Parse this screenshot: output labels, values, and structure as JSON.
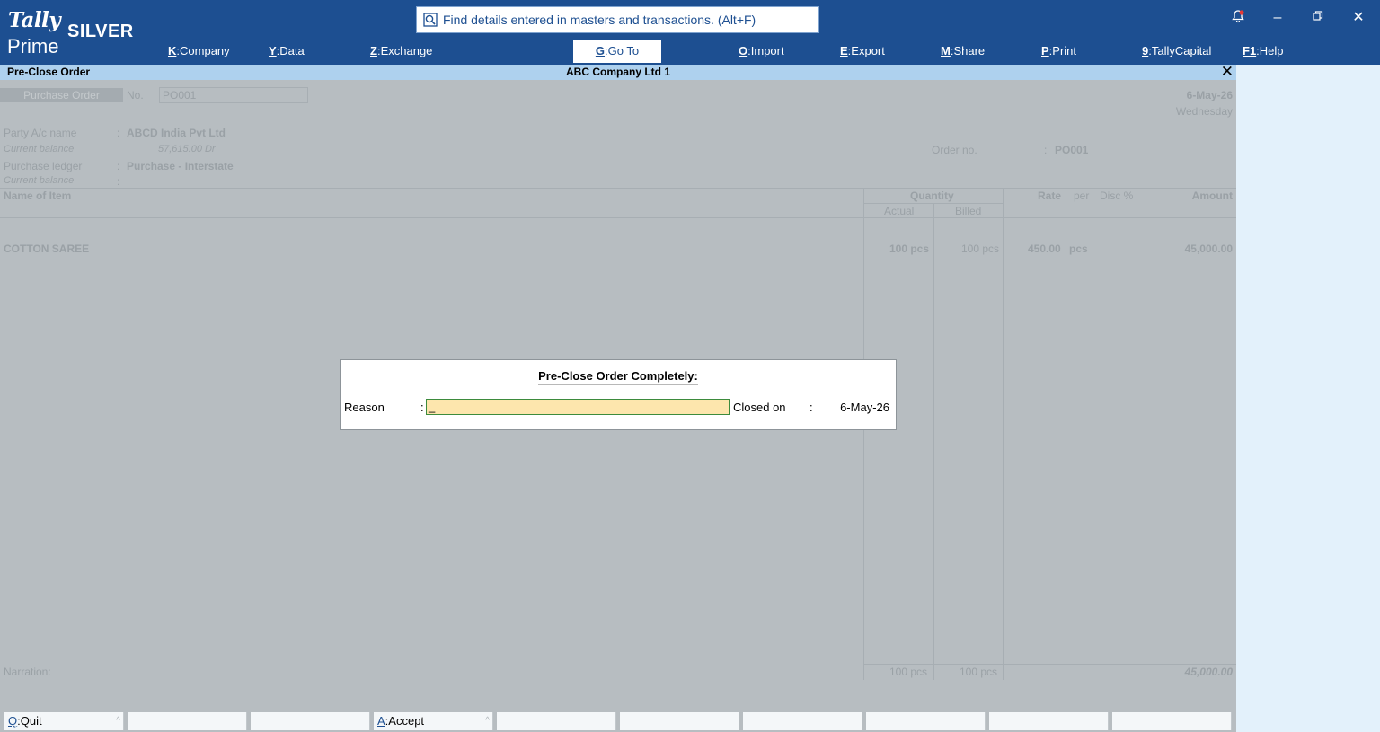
{
  "app": {
    "logo_tally": "Tally",
    "logo_prime": "Prime",
    "edition": "SILVER",
    "search_text": "Find details entered in masters and transactions. (Alt+F)"
  },
  "menu": [
    {
      "key": "K",
      "label": "Company"
    },
    {
      "key": "Y",
      "label": "Data"
    },
    {
      "key": "Z",
      "label": "Exchange"
    },
    {
      "key": "G",
      "label": "Go To"
    },
    {
      "key": "O",
      "label": "Import"
    },
    {
      "key": "E",
      "label": "Export"
    },
    {
      "key": "M",
      "label": "Share"
    },
    {
      "key": "P",
      "label": "Print"
    },
    {
      "key": "9",
      "label": "TallyCapital"
    },
    {
      "key": "F1",
      "label": "Help"
    }
  ],
  "icons": {
    "search": "search-icon",
    "bell": "notification-bell-icon",
    "minimize": "minimize-icon",
    "restore": "restore-icon",
    "close": "close-icon"
  },
  "title": {
    "screen": "Pre-Close Order",
    "company": "ABC Company Ltd 1"
  },
  "voucher": {
    "type": "Purchase Order",
    "no_label": "No.",
    "no_value": "PO001",
    "date": "6-May-26",
    "day": "Wednesday",
    "party_label": "Party A/c name",
    "party_value": "ABCD India Pvt Ltd",
    "party_bal_label": "Current balance",
    "party_bal_value": "57,615.00 Dr",
    "ledger_label": "Purchase ledger",
    "ledger_value": "Purchase - Interstate",
    "ledger_bal_label": "Current balance",
    "order_no_label": "Order no.",
    "order_no_value": "PO001",
    "columns": {
      "item": "Name of Item",
      "quantity": "Quantity",
      "actual": "Actual",
      "billed": "Billed",
      "rate": "Rate",
      "per": "per",
      "disc": "Disc %",
      "amount": "Amount"
    },
    "items": [
      {
        "name": "COTTON SAREE",
        "actual": "100 pcs",
        "billed": "100 pcs",
        "rate": "450.00",
        "per": "pcs",
        "amount": "45,000.00"
      }
    ],
    "narration_label": "Narration:",
    "totals": {
      "actual": "100 pcs",
      "billed": "100 pcs",
      "amount": "45,000.00"
    }
  },
  "modal": {
    "title": "Pre-Close Order Completely:",
    "reason_label": "Reason",
    "reason_value": "_",
    "closed_on_label": "Closed on",
    "closed_on_value": "6-May-26"
  },
  "buttons": [
    {
      "key": "Q",
      "label": "Quit"
    },
    {
      "key": "",
      "label": ""
    },
    {
      "key": "",
      "label": ""
    },
    {
      "key": "A",
      "label": "Accept"
    },
    {
      "key": "",
      "label": ""
    },
    {
      "key": "",
      "label": ""
    },
    {
      "key": "",
      "label": ""
    },
    {
      "key": "",
      "label": ""
    },
    {
      "key": "",
      "label": ""
    },
    {
      "key": "",
      "label": ""
    }
  ],
  "colors": {
    "topbar": "#1d4f91",
    "titlebar": "#aed1ee",
    "dim_overlay": "#b7bdc1",
    "input_bg": "#fde6ad"
  }
}
